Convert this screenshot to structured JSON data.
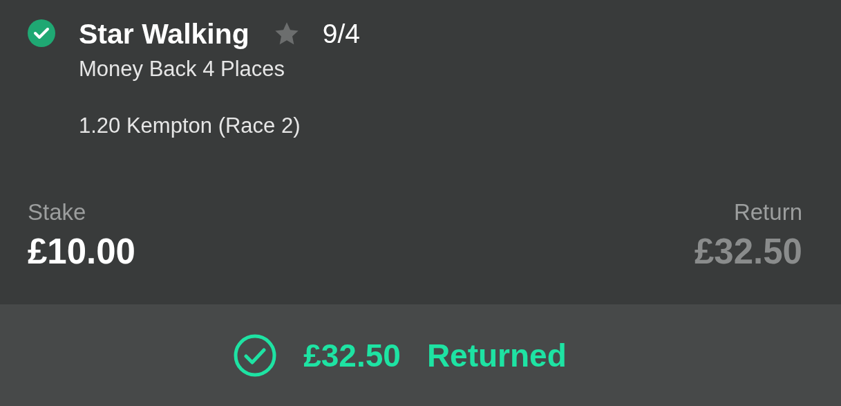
{
  "bet": {
    "settled": true,
    "selection": "Star Walking",
    "favourite": false,
    "odds": "9/4",
    "market": "Money Back 4 Places",
    "event": "1.20 Kempton (Race 2)"
  },
  "stake": {
    "label": "Stake",
    "value": "£10.00"
  },
  "return": {
    "label": "Return",
    "value": "£32.50"
  },
  "settlement": {
    "kind": "returned",
    "amount": "£32.50",
    "status": "Returned"
  }
}
